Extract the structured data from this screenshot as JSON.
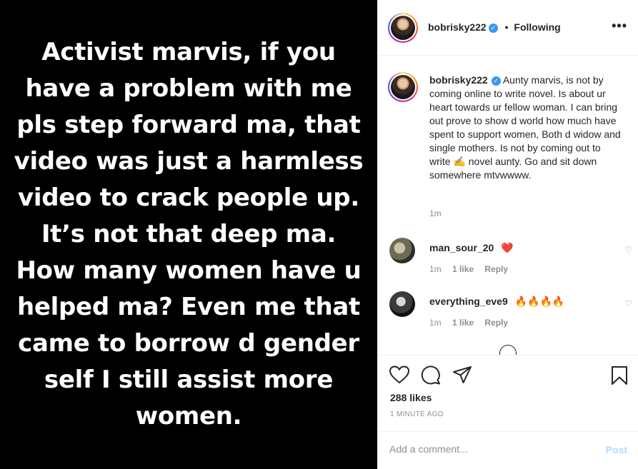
{
  "post": {
    "text": "Activist marvis, if you have a problem with me pls step forward ma, that video was just a harmless video to crack people up. It’s not that deep ma. How many women have u helped ma? Even me that came to borrow d gender self I still assist more women."
  },
  "header": {
    "username": "bobrisky222",
    "separator": "•",
    "follow_status": "Following",
    "more_label": "•••"
  },
  "caption": {
    "username": "bobrisky222",
    "text": "Aunty marvis, is not by coming online to write novel. Is about ur heart towards ur fellow woman. I can bring out prove to show d world how much have spent to support women, Both d widow and single mothers. Is not by coming out to write ✍️ novel aunty. Go and sit down somewhere mtvwwww.",
    "time": "1m"
  },
  "comments": [
    {
      "username": "man_sour_20",
      "text": "❤️",
      "time": "1m",
      "likes": "1 like",
      "reply": "Reply"
    },
    {
      "username": "everything_eve9",
      "text": "🔥🔥🔥🔥",
      "time": "1m",
      "likes": "1 like",
      "reply": "Reply"
    }
  ],
  "actions": {
    "likes": "288 likes",
    "time": "1 MINUTE AGO"
  },
  "add_comment": {
    "placeholder": "Add a comment...",
    "post_label": "Post"
  },
  "colors": {
    "verified": "#3897f0",
    "post_button": "#b3dbff",
    "heart": "#ed4956"
  }
}
